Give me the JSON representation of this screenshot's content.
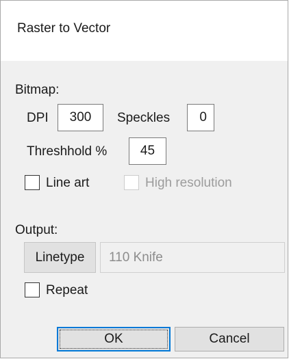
{
  "window": {
    "title": "Raster to Vector"
  },
  "bitmap": {
    "section_label": "Bitmap:",
    "dpi_label": "DPI",
    "dpi_value": "300",
    "speckles_label": "Speckles",
    "speckles_value": "0",
    "threshold_label": "Threshhold %",
    "threshold_value": "45",
    "line_art_label": "Line art",
    "line_art_checked": false,
    "high_resolution_label": "High resolution",
    "high_resolution_checked": false,
    "high_resolution_enabled": false
  },
  "output": {
    "section_label": "Output:",
    "linetype_button_label": "Linetype",
    "linetype_value": "110 Knife",
    "repeat_label": "Repeat",
    "repeat_checked": false
  },
  "buttons": {
    "ok_label": "OK",
    "cancel_label": "Cancel"
  },
  "colors": {
    "dialog_background": "#f0f0f0",
    "title_background": "#ffffff",
    "default_button_border": "#0078d7",
    "disabled_text": "#9c9c9c"
  }
}
